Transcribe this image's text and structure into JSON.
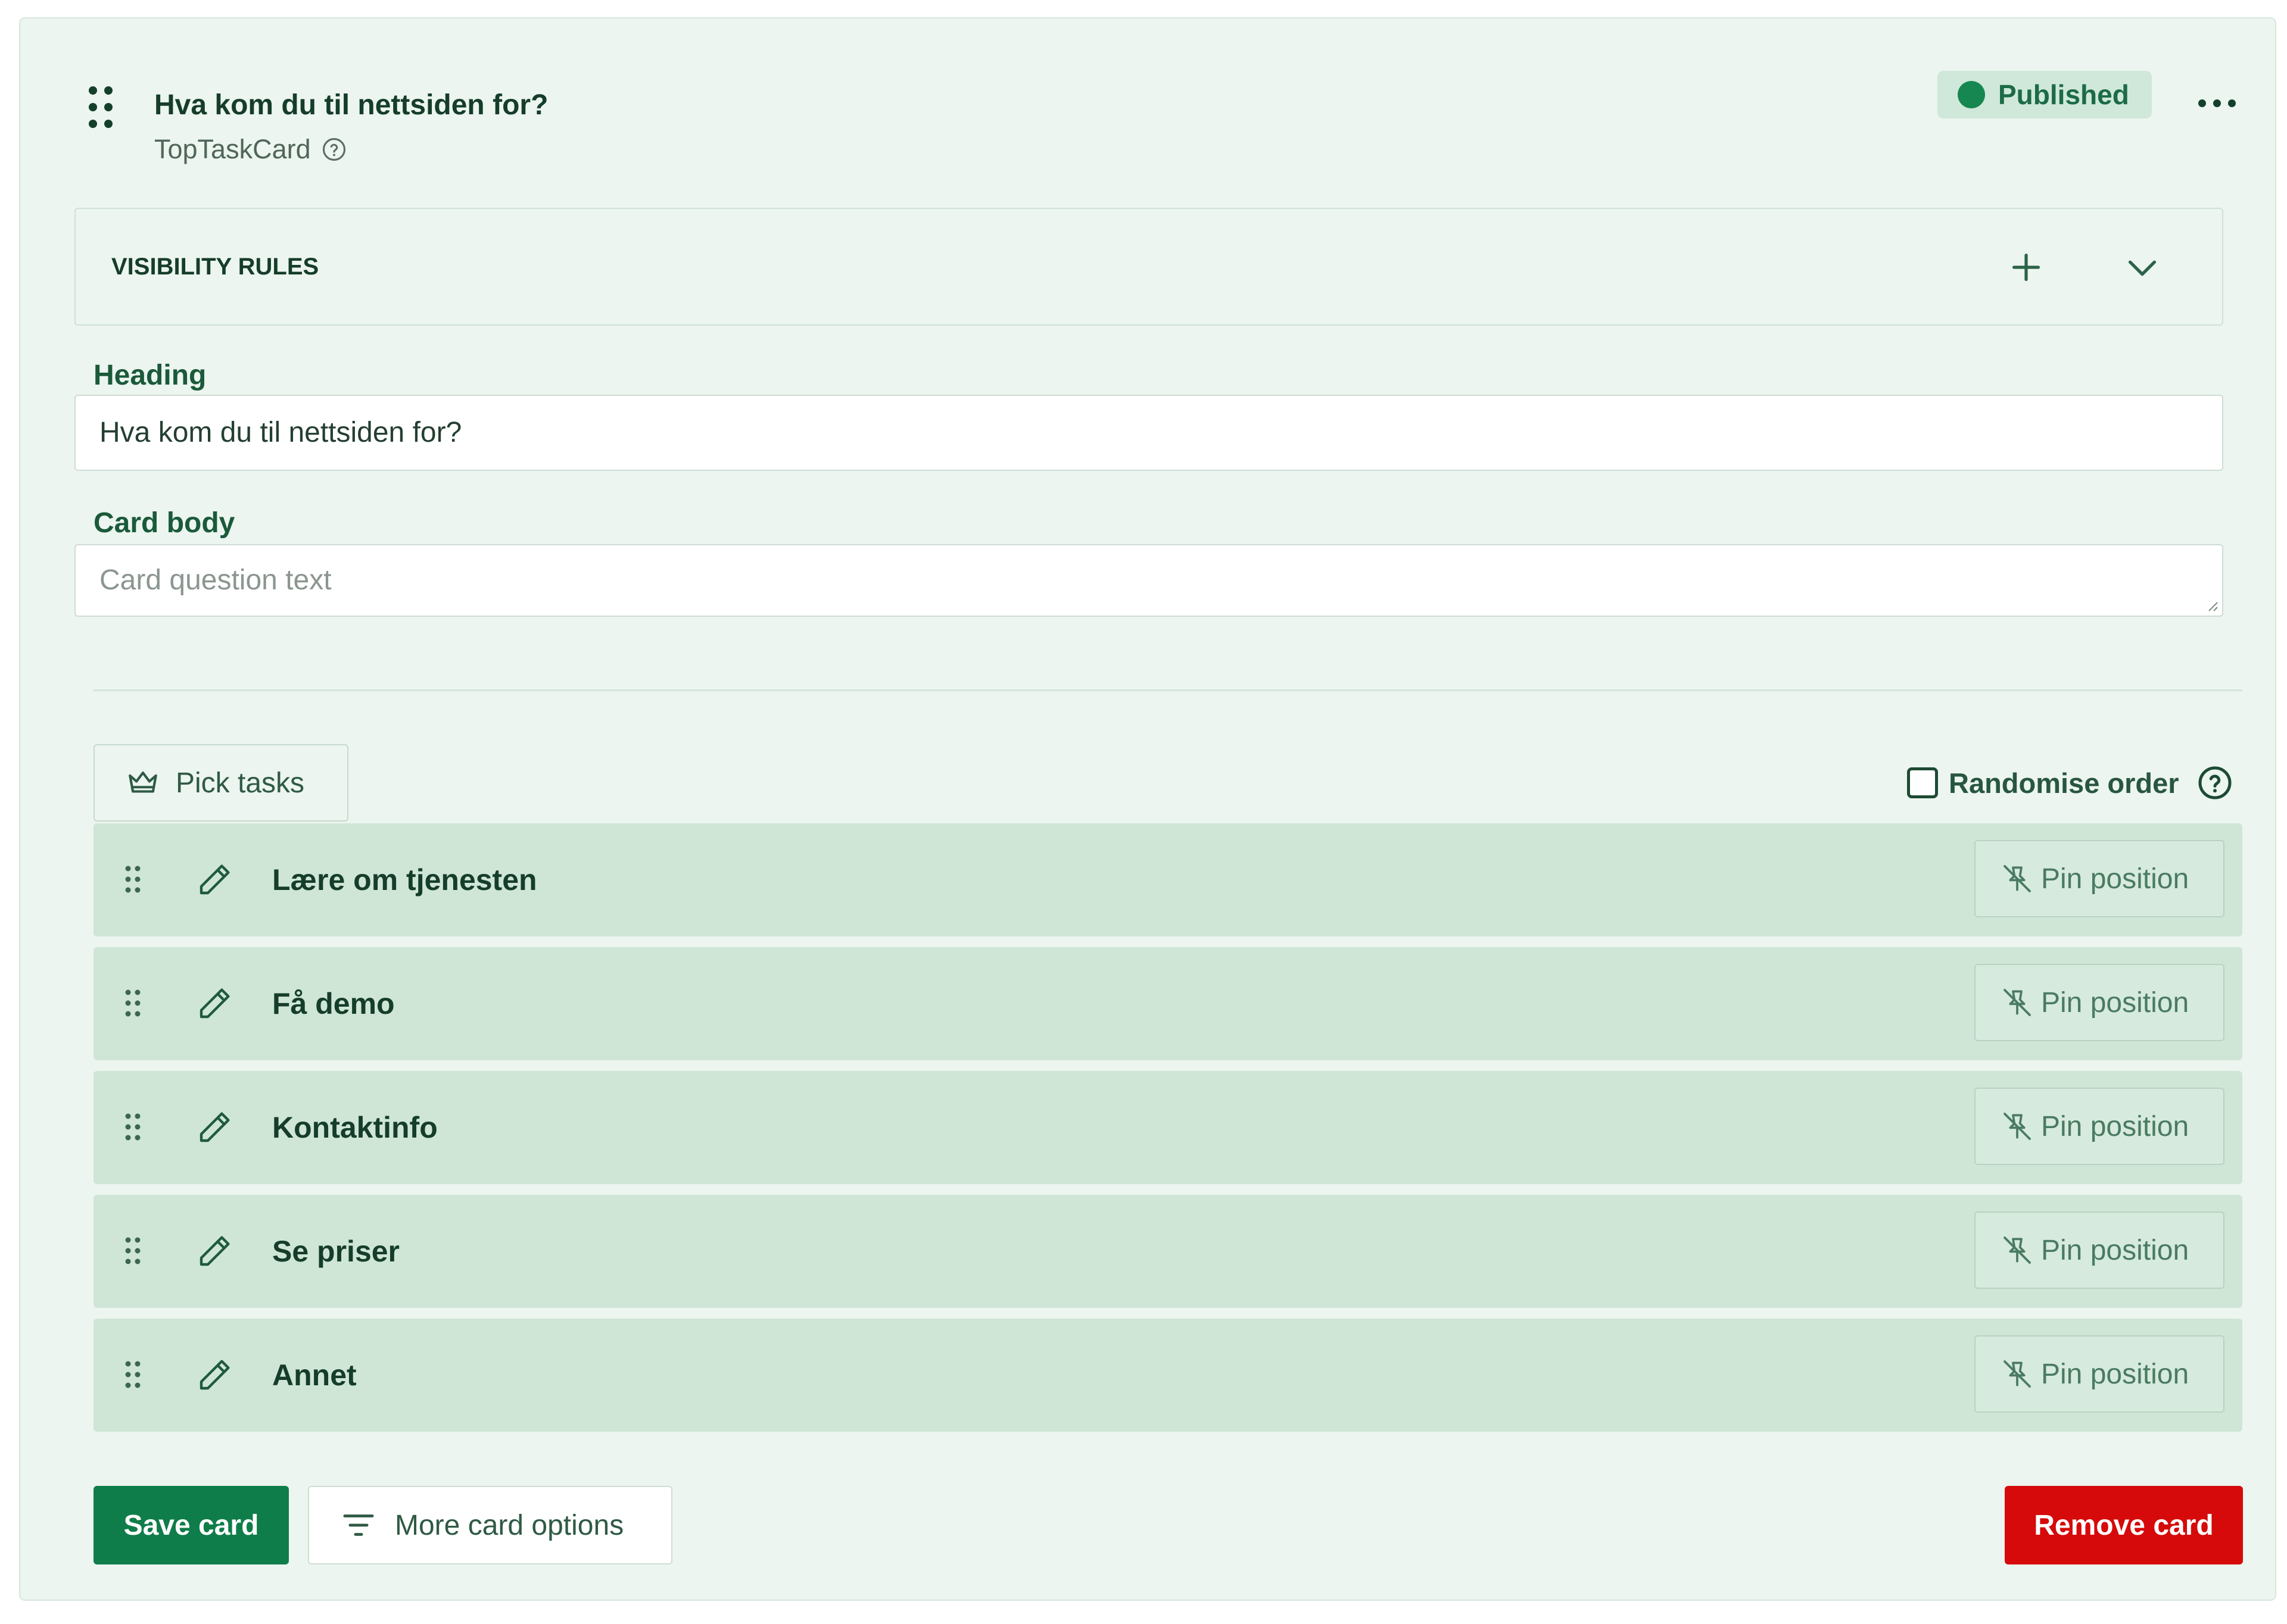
{
  "card": {
    "title": "Hva kom du til nettsiden for?",
    "subtitle": "TopTaskCard",
    "status": "Published"
  },
  "visibility": {
    "label": "VISIBILITY RULES"
  },
  "fields": {
    "heading_label": "Heading",
    "heading_value": "Hva kom du til nettsiden for?",
    "body_label": "Card body",
    "body_placeholder": "Card question text"
  },
  "tasks_toolbar": {
    "pick_label": "Pick tasks",
    "randomise_label": "Randomise order",
    "randomise_checked": false
  },
  "tasks": [
    {
      "label": "Lære om tjenesten",
      "pin_label": "Pin position"
    },
    {
      "label": "Få demo",
      "pin_label": "Pin position"
    },
    {
      "label": "Kontaktinfo",
      "pin_label": "Pin position"
    },
    {
      "label": "Se priser",
      "pin_label": "Pin position"
    },
    {
      "label": "Annet",
      "pin_label": "Pin position"
    }
  ],
  "actions": {
    "save_label": "Save card",
    "more_label": "More card options",
    "remove_label": "Remove card"
  },
  "colors": {
    "card_bg": "#ecf5ef",
    "row_bg": "#cfe6d7",
    "primary": "#0f7d4a",
    "danger": "#d60a0a",
    "status_dot": "#168750"
  },
  "icons": {
    "drag": "drag-grip-icon",
    "help": "help-circle-icon",
    "add": "plus-icon",
    "collapse": "chevron-down-icon",
    "pick": "crown-icon",
    "edit": "pencil-icon",
    "pin": "pin-off-icon",
    "filter": "filter-icon"
  }
}
